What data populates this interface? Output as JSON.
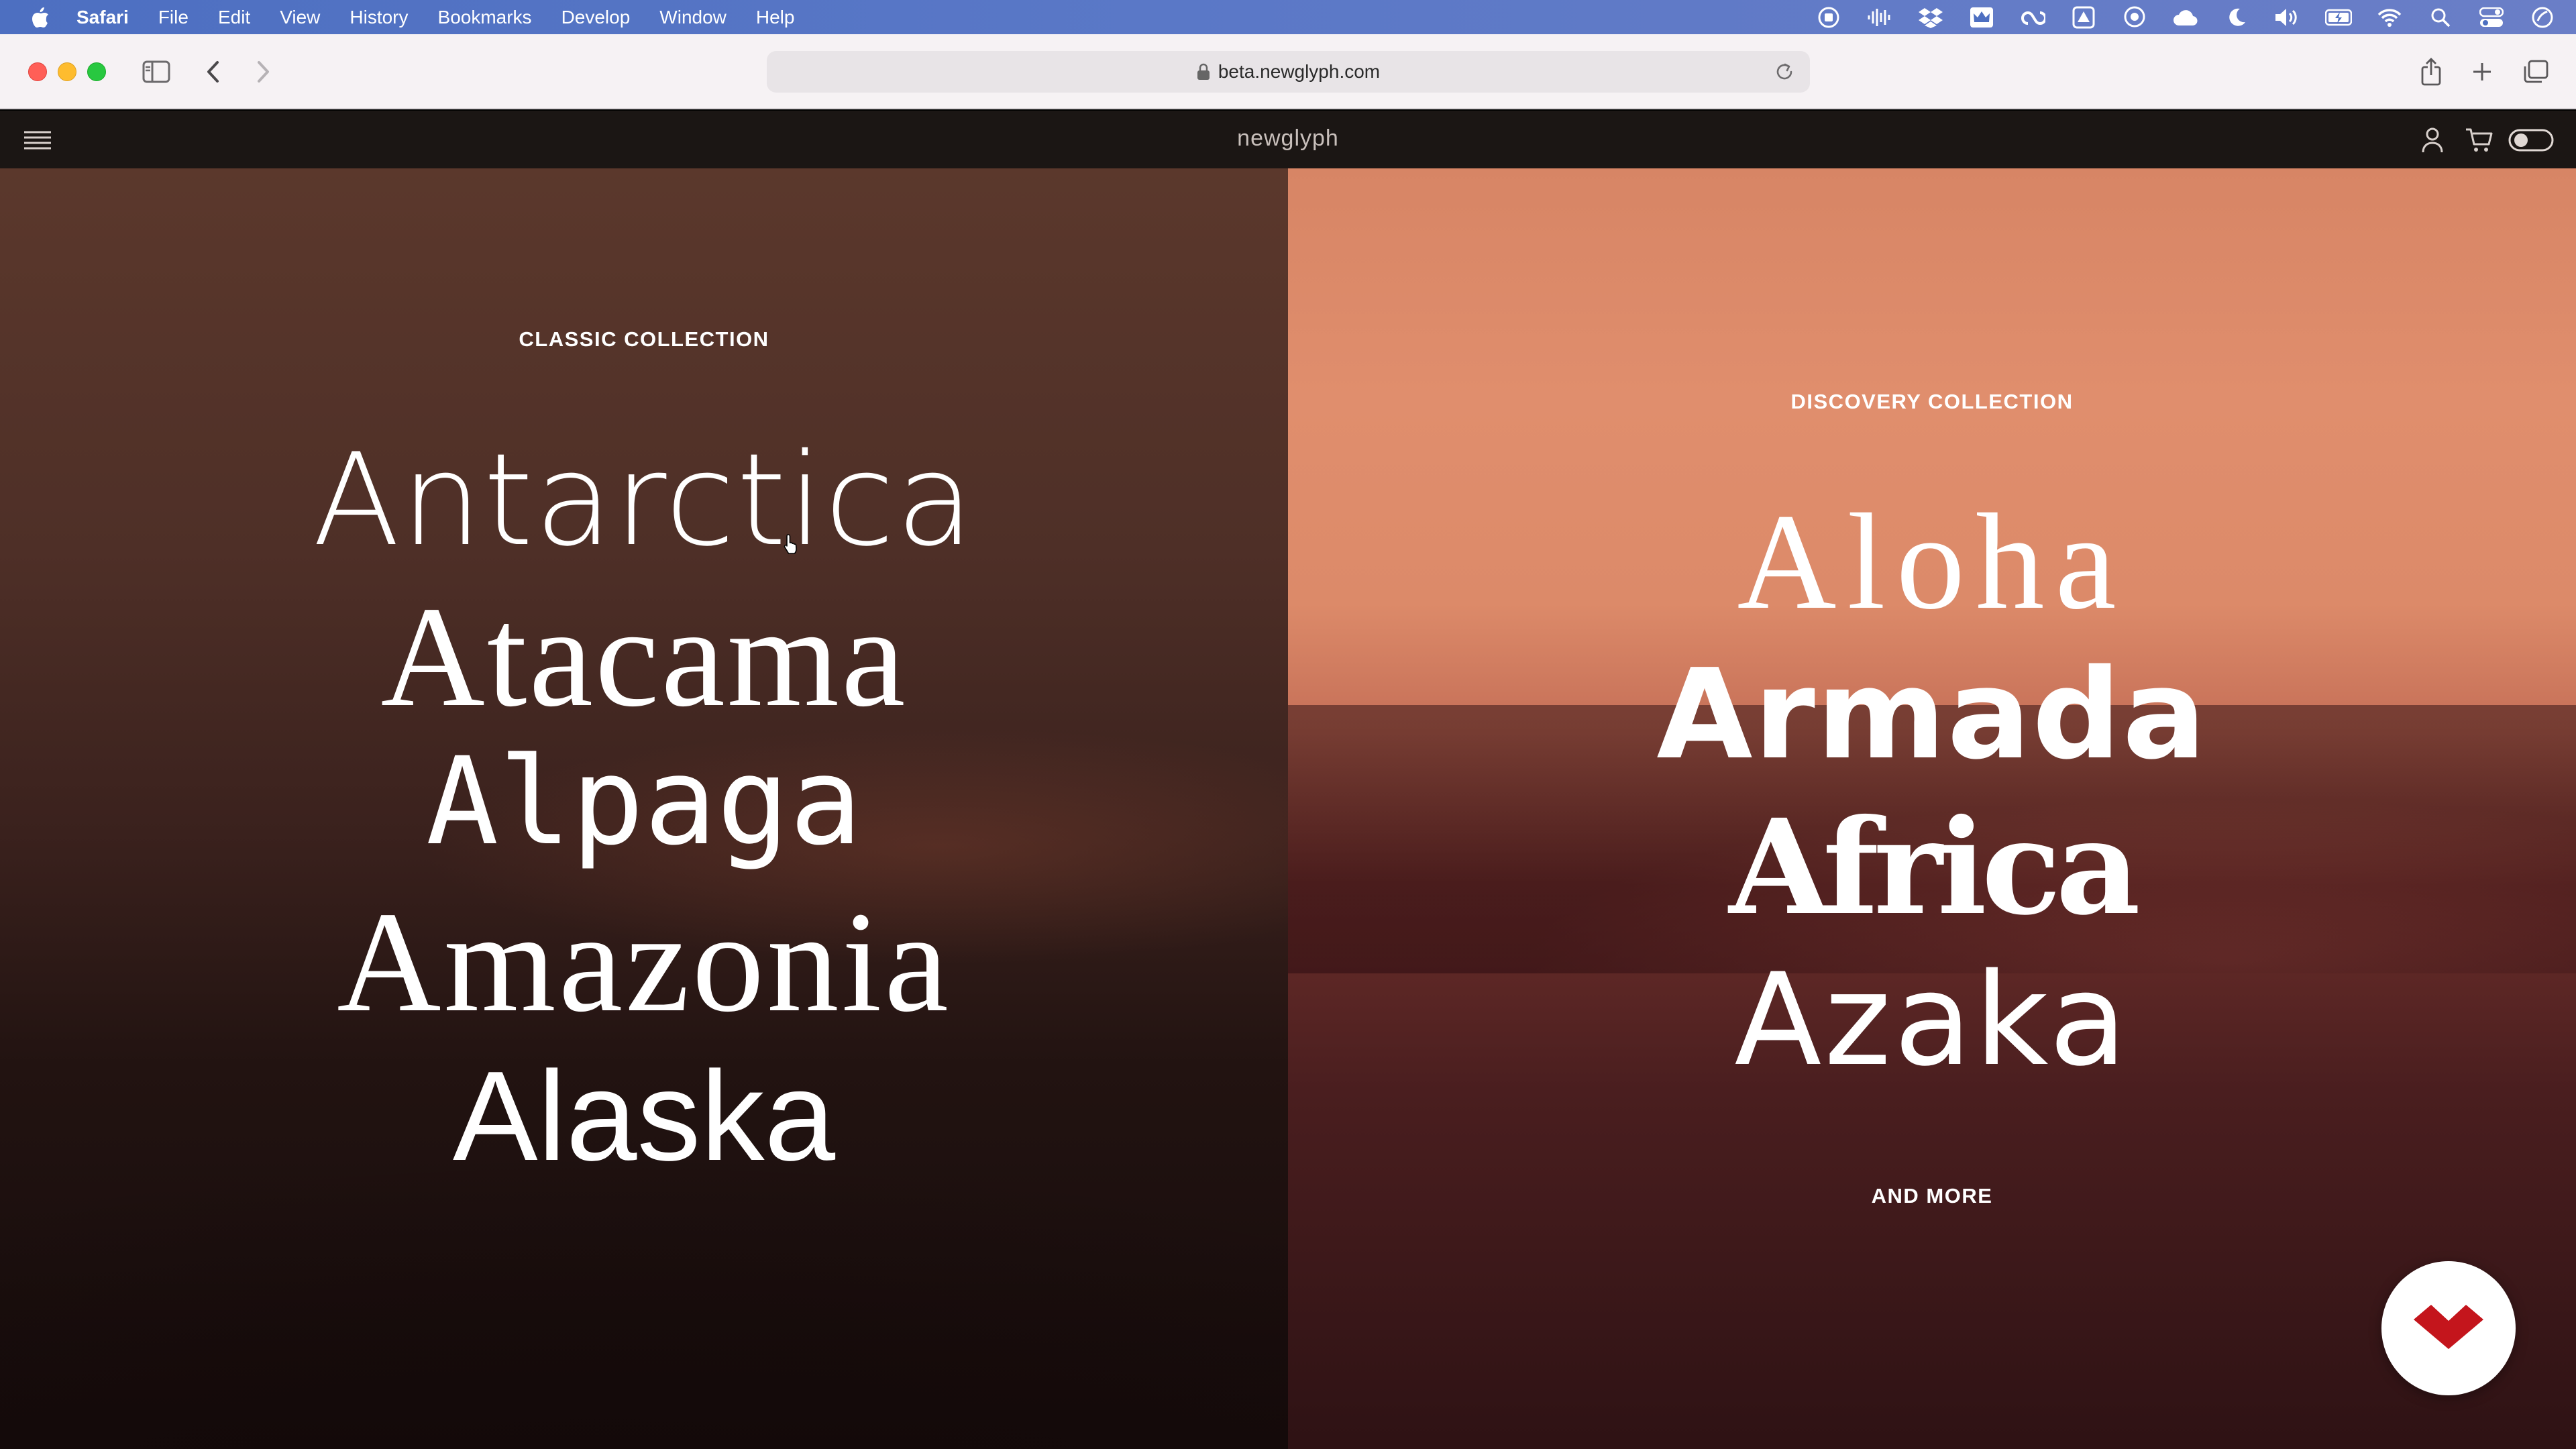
{
  "menubar": {
    "app_name": "Safari",
    "items": [
      "File",
      "Edit",
      "View",
      "History",
      "Bookmarks",
      "Develop",
      "Window",
      "Help"
    ],
    "status_icons": [
      "screen-record-icon",
      "audio-waveform-icon",
      "dropbox-icon",
      "crown-app-icon",
      "creative-cloud-icon",
      "drive-icon",
      "messenger-icon",
      "cloud-icon",
      "moon-icon",
      "volume-icon",
      "battery-icon",
      "wifi-icon",
      "spotlight-icon",
      "control-center-icon",
      "siri-icon"
    ]
  },
  "browser": {
    "url": "beta.newglyph.com"
  },
  "site": {
    "brand": "newglyph",
    "left": {
      "eyebrow": "CLASSIC COLLECTION",
      "fonts": [
        "Antarctica",
        "Atacama",
        "Alpaga",
        "Amazonia",
        "Alaska"
      ]
    },
    "right": {
      "eyebrow": "DISCOVERY COLLECTION",
      "fonts": [
        "Aloha",
        "Armada",
        "Africa",
        "Azaka"
      ],
      "more": "AND MORE"
    }
  },
  "colors": {
    "menubar": "#5a78c7",
    "toolbar": "#f6f2f4",
    "sitenav": "#1b1614",
    "left_panel": "#4e2f27",
    "right_panel": "#e08e6d",
    "badge_accent": "#c4151c"
  }
}
